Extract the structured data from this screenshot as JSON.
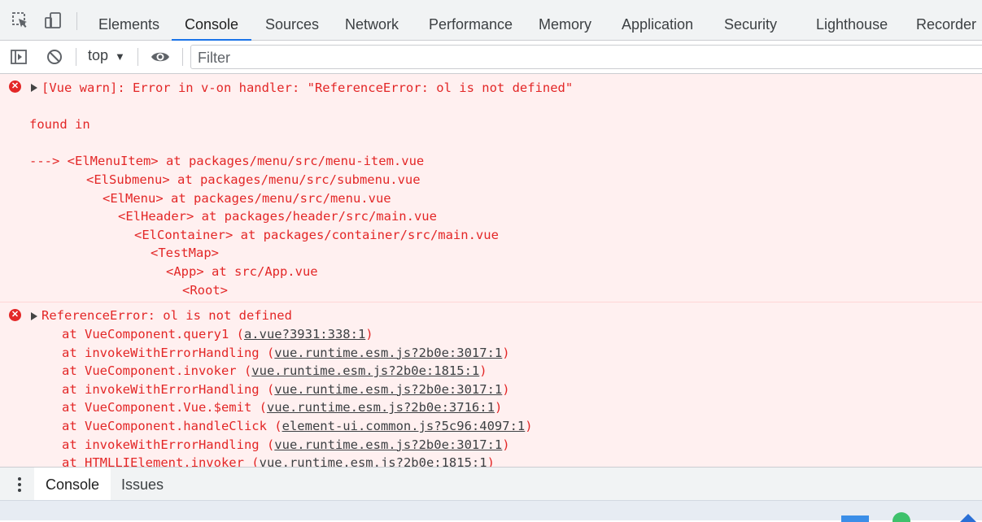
{
  "tabs": [
    {
      "label": "Elements"
    },
    {
      "label": "Console"
    },
    {
      "label": "Sources"
    },
    {
      "label": "Network"
    },
    {
      "label": "Performance"
    },
    {
      "label": "Memory"
    },
    {
      "label": "Application"
    },
    {
      "label": "Security"
    },
    {
      "label": "Lighthouse"
    },
    {
      "label": "Recorder"
    }
  ],
  "toolbar": {
    "context": "top",
    "filter_placeholder": "Filter"
  },
  "messages": [
    {
      "lines": [
        "[Vue warn]: Error in v-on handler: \"ReferenceError: ol is not defined\"",
        "found in",
        "---> <ElMenuItem> at packages/menu/src/menu-item.vue",
        "<ElSubmenu> at packages/menu/src/submenu.vue",
        "<ElMenu> at packages/menu/src/menu.vue",
        "<ElHeader> at packages/header/src/main.vue",
        "<ElContainer> at packages/container/src/main.vue",
        "<TestMap>",
        "<App> at src/App.vue",
        "<Root>"
      ]
    },
    {
      "first": "ReferenceError: ol is not defined",
      "stack": [
        {
          "fn": "at VueComponent.query1 (",
          "src": "a.vue?3931:338:1"
        },
        {
          "fn": "at invokeWithErrorHandling (",
          "src": "vue.runtime.esm.js?2b0e:3017:1"
        },
        {
          "fn": "at VueComponent.invoker (",
          "src": "vue.runtime.esm.js?2b0e:1815:1"
        },
        {
          "fn": "at invokeWithErrorHandling (",
          "src": "vue.runtime.esm.js?2b0e:3017:1"
        },
        {
          "fn": "at VueComponent.Vue.$emit (",
          "src": "vue.runtime.esm.js?2b0e:3716:1"
        },
        {
          "fn": "at VueComponent.handleClick (",
          "src": "element-ui.common.js?5c96:4097:1"
        },
        {
          "fn": "at invokeWithErrorHandling (",
          "src": "vue.runtime.esm.js?2b0e:3017:1"
        },
        {
          "fn": "at HTMLLIElement.invoker (",
          "src": "vue.runtime.esm.js?2b0e:1815:1"
        }
      ]
    }
  ],
  "drawer": {
    "tabs": [
      {
        "label": "Console"
      },
      {
        "label": "Issues"
      }
    ]
  },
  "colors": {
    "error": "#e32727",
    "error_bg": "#fff0f0",
    "accent": "#1a73e8"
  }
}
